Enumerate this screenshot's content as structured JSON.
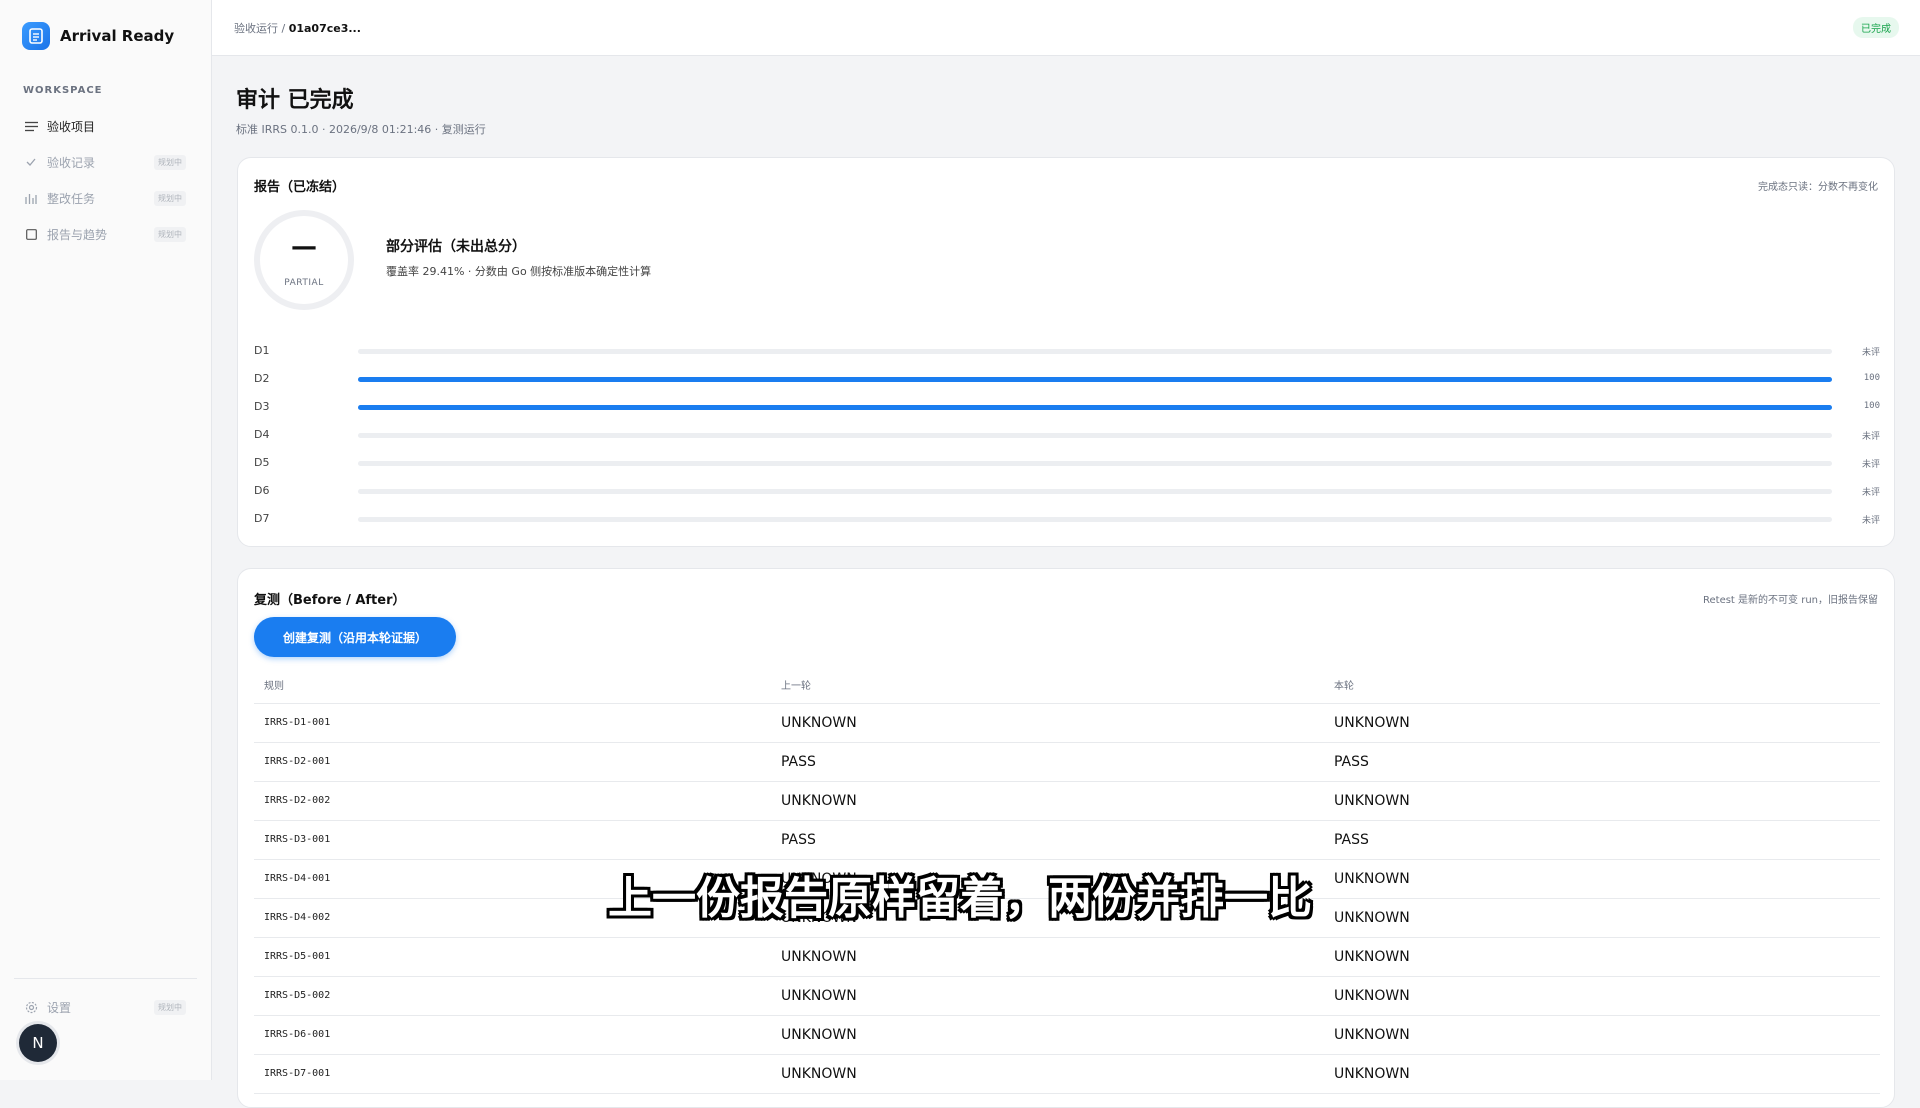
{
  "app": {
    "name": "Arrival Ready"
  },
  "sidebar": {
    "section_label": "WORKSPACE",
    "items": [
      {
        "label": "验收项目",
        "icon": "list-icon",
        "badge": "",
        "active": true
      },
      {
        "label": "验收记录",
        "icon": "check-icon",
        "badge": "规划中",
        "active": false
      },
      {
        "label": "整改任务",
        "icon": "bar-chart-icon",
        "badge": "规划中",
        "active": false
      },
      {
        "label": "报告与趋势",
        "icon": "square-icon",
        "badge": "规划中",
        "active": false
      }
    ],
    "settings": {
      "label": "设置",
      "badge": "规划中"
    },
    "avatar_initial": "N"
  },
  "topbar": {
    "breadcrumb_parent": "验收运行",
    "breadcrumb_separator": " / ",
    "breadcrumb_current": "01a07ce3...",
    "status_badge": "已完成"
  },
  "page": {
    "title": "审计 已完成",
    "subtitle": "标准 IRRS 0.1.0 · 2026/9/8 01:21:46 · 复测运行"
  },
  "report": {
    "title": "报告（已冻结）",
    "note": "完成态只读：分数不再变化",
    "score_value": "—",
    "score_label": "PARTIAL",
    "summary_title": "部分评估（未出总分）",
    "summary_desc": "覆盖率 29.41% · 分数由 Go 侧按标准版本确定性计算",
    "dimensions": [
      {
        "label": "D1",
        "value": null,
        "display": "未评"
      },
      {
        "label": "D2",
        "value": 100,
        "display": "100"
      },
      {
        "label": "D3",
        "value": 100,
        "display": "100"
      },
      {
        "label": "D4",
        "value": null,
        "display": "未评"
      },
      {
        "label": "D5",
        "value": null,
        "display": "未评"
      },
      {
        "label": "D6",
        "value": null,
        "display": "未评"
      },
      {
        "label": "D7",
        "value": null,
        "display": "未评"
      }
    ],
    "bar_color": "#1a7df0"
  },
  "retest": {
    "title": "复测（Before / After）",
    "note": "Retest 是新的不可变 run，旧报告保留",
    "create_button": "创建复测（沿用本轮证据）",
    "columns": [
      "规则",
      "上一轮",
      "本轮"
    ],
    "rows": [
      [
        "IRRS-D1-001",
        "UNKNOWN",
        "UNKNOWN"
      ],
      [
        "IRRS-D2-001",
        "PASS",
        "PASS"
      ],
      [
        "IRRS-D2-002",
        "UNKNOWN",
        "UNKNOWN"
      ],
      [
        "IRRS-D3-001",
        "PASS",
        "PASS"
      ],
      [
        "IRRS-D4-001",
        "UNKNOWN",
        "UNKNOWN"
      ],
      [
        "IRRS-D4-002",
        "UNKNOWN",
        "UNKNOWN"
      ],
      [
        "IRRS-D5-001",
        "UNKNOWN",
        "UNKNOWN"
      ],
      [
        "IRRS-D5-002",
        "UNKNOWN",
        "UNKNOWN"
      ],
      [
        "IRRS-D6-001",
        "UNKNOWN",
        "UNKNOWN"
      ],
      [
        "IRRS-D7-001",
        "UNKNOWN",
        "UNKNOWN"
      ]
    ]
  },
  "video_subtitle": "上一份报告原样留着，两份并排一比",
  "colors": {
    "accent": "#1a7df0",
    "success": "#16a34a"
  }
}
